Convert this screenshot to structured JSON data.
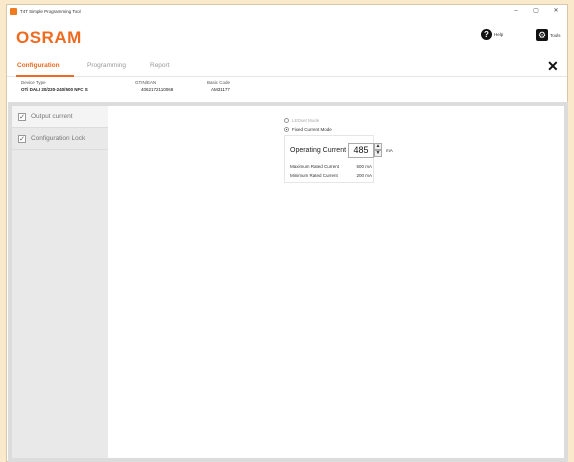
{
  "window": {
    "title": "T4T Simple Programming Tool",
    "minimize": "–",
    "maximize": "▢",
    "close": "✕"
  },
  "brand": {
    "logo": "OSRAM",
    "help_label": "Help",
    "tools_label": "Tools"
  },
  "tabs": [
    {
      "label": "Configuration",
      "active": true
    },
    {
      "label": "Programming",
      "active": false
    },
    {
      "label": "Report",
      "active": false
    }
  ],
  "device": {
    "type_label": "Device Type",
    "type_value": "OTi DALI 20/220-240/500 NFC S",
    "gtin_label": "GTIN/EAN",
    "gtin_value": "4062172110068",
    "basic_label": "Basic Code",
    "basic_value": "AM31177"
  },
  "sidebar": {
    "items": [
      {
        "label": "Output current",
        "checked": true
      },
      {
        "label": "Configuration Lock",
        "checked": true
      }
    ]
  },
  "modes": {
    "ledset_label": "LEDset Mode",
    "fixed_label": "Fixed Current Mode",
    "selected": "fixed"
  },
  "current": {
    "label": "Operating Current",
    "value": "485",
    "unit": "mA",
    "max_label": "Maximum Rated Current",
    "max_value": "500 mA",
    "min_label": "Minimum Rated Current",
    "min_value": "200 mA"
  },
  "colors": {
    "accent": "#ee6a1f",
    "background": "#fbe9cc"
  }
}
